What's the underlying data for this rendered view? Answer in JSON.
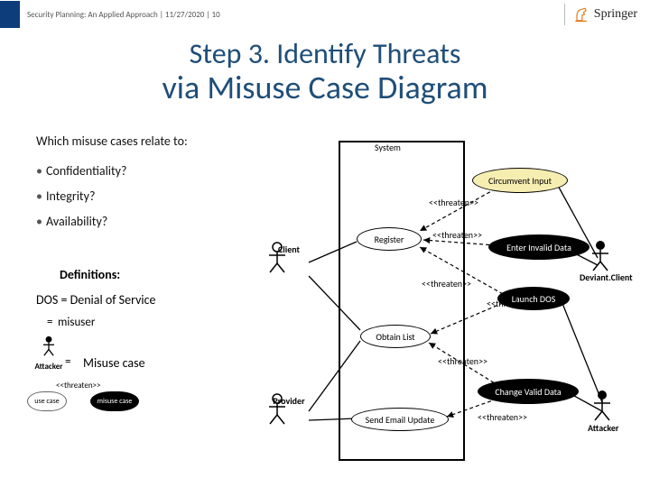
{
  "header": {
    "breadcrumb": "Security Planning: An Applied Approach | 11/27/2020 | 10",
    "brand": "Springer"
  },
  "title": {
    "line1": "Step 3.  Identify Threats",
    "line2": "via Misuse Case Diagram"
  },
  "prompt": "Which misuse cases relate to:",
  "bullets": {
    "b1": "Confidentiality?",
    "b2": "Integrity?",
    "b3": "Availability?"
  },
  "definitions": {
    "heading": "Definitions:",
    "dos": "DOS = Denial of Service",
    "legend_misuser": "misuser",
    "legend_misuse_case": "Misuse case"
  },
  "legend_small": {
    "attacker": "Attacker",
    "threaten": "<<threaten>>",
    "use_case": "use case",
    "misuse_case": "misuse case"
  },
  "diagram": {
    "system_label": "System",
    "actors": {
      "client": "Client",
      "provider": "Provider",
      "deviant_client": "Deviant.Client",
      "attacker": "Attacker"
    },
    "use_cases": {
      "register": "Register",
      "obtain_list": "Obtain List",
      "send_email": "Send Email Update"
    },
    "misuse_cases": {
      "circumvent_input": "Circumvent Input",
      "enter_invalid": "Enter Invalid Data",
      "launch_dos": "Launch DOS",
      "change_valid": "Change Valid Data"
    },
    "stereotype": "<<threaten>>"
  }
}
